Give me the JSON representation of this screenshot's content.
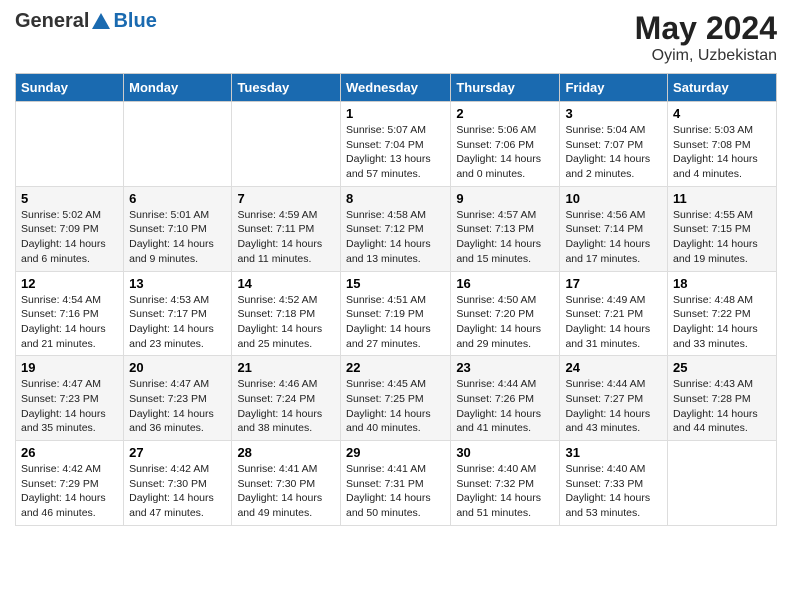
{
  "header": {
    "logo_general": "General",
    "logo_blue": "Blue",
    "month_year": "May 2024",
    "location": "Oyim, Uzbekistan"
  },
  "days_of_week": [
    "Sunday",
    "Monday",
    "Tuesday",
    "Wednesday",
    "Thursday",
    "Friday",
    "Saturday"
  ],
  "weeks": [
    [
      {
        "day": "",
        "info": ""
      },
      {
        "day": "",
        "info": ""
      },
      {
        "day": "",
        "info": ""
      },
      {
        "day": "1",
        "info": "Sunrise: 5:07 AM\nSunset: 7:04 PM\nDaylight: 13 hours\nand 57 minutes."
      },
      {
        "day": "2",
        "info": "Sunrise: 5:06 AM\nSunset: 7:06 PM\nDaylight: 14 hours\nand 0 minutes."
      },
      {
        "day": "3",
        "info": "Sunrise: 5:04 AM\nSunset: 7:07 PM\nDaylight: 14 hours\nand 2 minutes."
      },
      {
        "day": "4",
        "info": "Sunrise: 5:03 AM\nSunset: 7:08 PM\nDaylight: 14 hours\nand 4 minutes."
      }
    ],
    [
      {
        "day": "5",
        "info": "Sunrise: 5:02 AM\nSunset: 7:09 PM\nDaylight: 14 hours\nand 6 minutes."
      },
      {
        "day": "6",
        "info": "Sunrise: 5:01 AM\nSunset: 7:10 PM\nDaylight: 14 hours\nand 9 minutes."
      },
      {
        "day": "7",
        "info": "Sunrise: 4:59 AM\nSunset: 7:11 PM\nDaylight: 14 hours\nand 11 minutes."
      },
      {
        "day": "8",
        "info": "Sunrise: 4:58 AM\nSunset: 7:12 PM\nDaylight: 14 hours\nand 13 minutes."
      },
      {
        "day": "9",
        "info": "Sunrise: 4:57 AM\nSunset: 7:13 PM\nDaylight: 14 hours\nand 15 minutes."
      },
      {
        "day": "10",
        "info": "Sunrise: 4:56 AM\nSunset: 7:14 PM\nDaylight: 14 hours\nand 17 minutes."
      },
      {
        "day": "11",
        "info": "Sunrise: 4:55 AM\nSunset: 7:15 PM\nDaylight: 14 hours\nand 19 minutes."
      }
    ],
    [
      {
        "day": "12",
        "info": "Sunrise: 4:54 AM\nSunset: 7:16 PM\nDaylight: 14 hours\nand 21 minutes."
      },
      {
        "day": "13",
        "info": "Sunrise: 4:53 AM\nSunset: 7:17 PM\nDaylight: 14 hours\nand 23 minutes."
      },
      {
        "day": "14",
        "info": "Sunrise: 4:52 AM\nSunset: 7:18 PM\nDaylight: 14 hours\nand 25 minutes."
      },
      {
        "day": "15",
        "info": "Sunrise: 4:51 AM\nSunset: 7:19 PM\nDaylight: 14 hours\nand 27 minutes."
      },
      {
        "day": "16",
        "info": "Sunrise: 4:50 AM\nSunset: 7:20 PM\nDaylight: 14 hours\nand 29 minutes."
      },
      {
        "day": "17",
        "info": "Sunrise: 4:49 AM\nSunset: 7:21 PM\nDaylight: 14 hours\nand 31 minutes."
      },
      {
        "day": "18",
        "info": "Sunrise: 4:48 AM\nSunset: 7:22 PM\nDaylight: 14 hours\nand 33 minutes."
      }
    ],
    [
      {
        "day": "19",
        "info": "Sunrise: 4:47 AM\nSunset: 7:23 PM\nDaylight: 14 hours\nand 35 minutes."
      },
      {
        "day": "20",
        "info": "Sunrise: 4:47 AM\nSunset: 7:23 PM\nDaylight: 14 hours\nand 36 minutes."
      },
      {
        "day": "21",
        "info": "Sunrise: 4:46 AM\nSunset: 7:24 PM\nDaylight: 14 hours\nand 38 minutes."
      },
      {
        "day": "22",
        "info": "Sunrise: 4:45 AM\nSunset: 7:25 PM\nDaylight: 14 hours\nand 40 minutes."
      },
      {
        "day": "23",
        "info": "Sunrise: 4:44 AM\nSunset: 7:26 PM\nDaylight: 14 hours\nand 41 minutes."
      },
      {
        "day": "24",
        "info": "Sunrise: 4:44 AM\nSunset: 7:27 PM\nDaylight: 14 hours\nand 43 minutes."
      },
      {
        "day": "25",
        "info": "Sunrise: 4:43 AM\nSunset: 7:28 PM\nDaylight: 14 hours\nand 44 minutes."
      }
    ],
    [
      {
        "day": "26",
        "info": "Sunrise: 4:42 AM\nSunset: 7:29 PM\nDaylight: 14 hours\nand 46 minutes."
      },
      {
        "day": "27",
        "info": "Sunrise: 4:42 AM\nSunset: 7:30 PM\nDaylight: 14 hours\nand 47 minutes."
      },
      {
        "day": "28",
        "info": "Sunrise: 4:41 AM\nSunset: 7:30 PM\nDaylight: 14 hours\nand 49 minutes."
      },
      {
        "day": "29",
        "info": "Sunrise: 4:41 AM\nSunset: 7:31 PM\nDaylight: 14 hours\nand 50 minutes."
      },
      {
        "day": "30",
        "info": "Sunrise: 4:40 AM\nSunset: 7:32 PM\nDaylight: 14 hours\nand 51 minutes."
      },
      {
        "day": "31",
        "info": "Sunrise: 4:40 AM\nSunset: 7:33 PM\nDaylight: 14 hours\nand 53 minutes."
      },
      {
        "day": "",
        "info": ""
      }
    ]
  ]
}
